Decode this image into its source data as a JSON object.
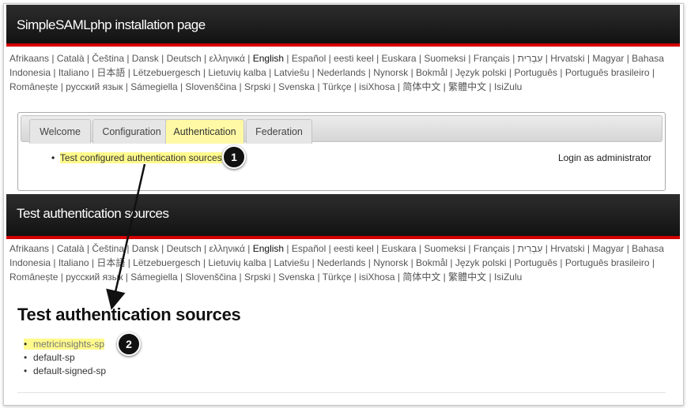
{
  "top_header": {
    "title": "SimpleSAMLphp installation page"
  },
  "languages": {
    "items": [
      "Afrikaans",
      "Català",
      "Čeština",
      "Dansk",
      "Deutsch",
      "ελληνικά",
      "English",
      "Español",
      "eesti keel",
      "Euskara",
      "Suomeksi",
      "Français",
      "עִבְרִית",
      "Hrvatski",
      "Magyar",
      "Bahasa Indonesia",
      "Italiano",
      "日本語",
      "Lëtzebuergesch",
      "Lietuvių kalba",
      "Latviešu",
      "Nederlands",
      "Nynorsk",
      "Bokmål",
      "Język polski",
      "Português",
      "Português brasileiro",
      "Românește",
      "русский язык",
      "Sámegiella",
      "Slovenščina",
      "Srpski",
      "Svenska",
      "Türkçe",
      "isiXhosa",
      "简体中文",
      "繁體中文",
      "IsiZulu"
    ],
    "current": "English"
  },
  "tabs": {
    "items": [
      "Welcome",
      "Configuration",
      "Authentication",
      "Federation"
    ],
    "active": "Authentication"
  },
  "auth_panel": {
    "link": "Test configured authentication sources",
    "admin_link": "Login as administrator"
  },
  "bottom_header": {
    "title": "Test authentication sources"
  },
  "main": {
    "title": "Test authentication sources",
    "sources": [
      "metricinsights-sp",
      "default-sp",
      "default-signed-sp"
    ]
  },
  "callouts": {
    "one": "1",
    "two": "2"
  },
  "colors": {
    "accent_red": "#d40000",
    "highlight": "#fffa8c",
    "active_tab": "#fff9a5"
  }
}
